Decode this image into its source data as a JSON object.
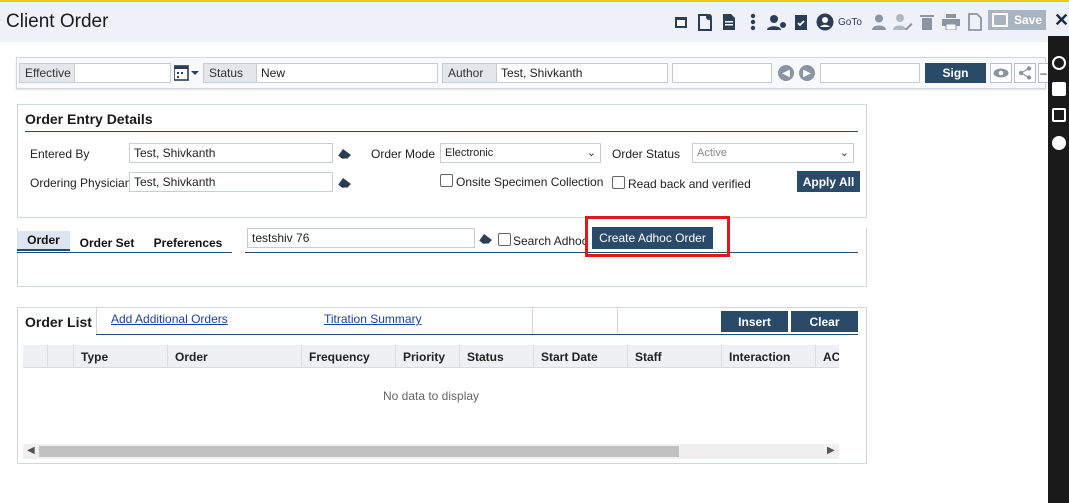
{
  "window": {
    "title": "Client Order"
  },
  "toolbar": {
    "goto_label": "GoTo",
    "save_label": "Save",
    "icons": [
      "calendar-icon",
      "document-add-icon",
      "document-icon",
      "more-vertical-icon",
      "user-settings-icon",
      "clipboard-check-icon",
      "account-circle-icon",
      "person-icon",
      "person-edit-icon",
      "trash-icon",
      "print-icon",
      "blank-document-icon"
    ]
  },
  "header": {
    "effective_label": "Effective",
    "effective_value": "",
    "status_label": "Status",
    "status_value": "New",
    "author_label": "Author",
    "author_value": "Test, Shivkanth",
    "sign_label": "Sign"
  },
  "order_entry": {
    "title": "Order Entry Details",
    "entered_by_label": "Entered By",
    "entered_by_value": "Test, Shivkanth",
    "ordering_physician_label": "Ordering Physician",
    "ordering_physician_value": "Test, Shivkanth",
    "order_mode_label": "Order Mode",
    "order_mode_value": "Electronic",
    "order_status_label": "Order Status",
    "order_status_value": "Active",
    "onsite_label": "Onsite Specimen Collection",
    "readback_label": "Read back and verified",
    "apply_all_label": "Apply All"
  },
  "order_tabs": {
    "tabs": [
      "Order",
      "Order Set",
      "Preferences"
    ],
    "active": "Order",
    "search_value": "testshiv 76",
    "search_adhoc_label": "Search Adhoc",
    "create_adhoc_label": "Create Adhoc Order"
  },
  "order_list": {
    "title": "Order List",
    "links": [
      "Add Additional Orders",
      "Titration Summary"
    ],
    "insert_label": "Insert",
    "clear_label": "Clear",
    "columns": [
      "Type",
      "Order",
      "Frequency",
      "Priority",
      "Status",
      "Start Date",
      "Staff",
      "Interaction",
      "ACK"
    ],
    "empty_text": "No data to display"
  },
  "colors": {
    "accent": "#2a4a6a",
    "highlight": "#e0191f",
    "link": "#1a3fa8"
  }
}
